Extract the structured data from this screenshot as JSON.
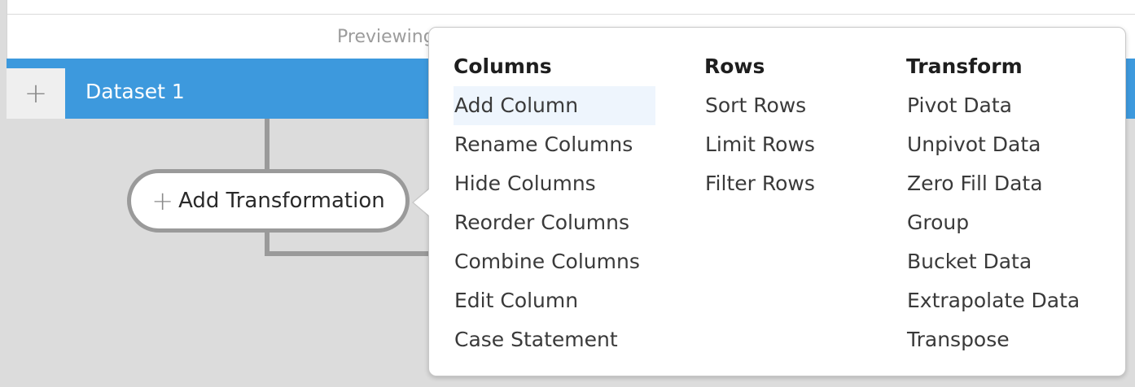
{
  "top": {
    "preview_text": "Previewing"
  },
  "dataset": {
    "add_symbol": "+",
    "label": "Dataset 1"
  },
  "add_transformation": {
    "plus": "+",
    "label": "Add Transformation"
  },
  "menu": {
    "columns": {
      "title": "Columns",
      "items": [
        "Add Column",
        "Rename Columns",
        "Hide Columns",
        "Reorder Columns",
        "Combine Columns",
        "Edit Column",
        "Case Statement"
      ],
      "hovered_item": "Add Column"
    },
    "rows": {
      "title": "Rows",
      "items": [
        "Sort Rows",
        "Limit Rows",
        "Filter Rows"
      ]
    },
    "transform": {
      "title": "Transform",
      "items": [
        "Pivot Data",
        "Unpivot Data",
        "Zero Fill Data",
        "Group",
        "Bucket Data",
        "Extrapolate Data",
        "Transpose"
      ]
    }
  },
  "colors": {
    "dataset_bar": "#3d99dd",
    "menu_hover": "#eef5fd",
    "connector": "#9a9a9a"
  }
}
